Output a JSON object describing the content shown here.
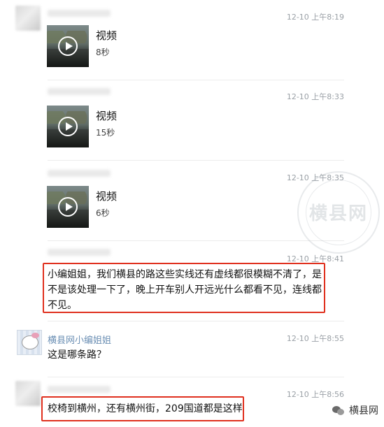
{
  "messages": [
    {
      "time": "12-10 上午8:19",
      "video_title": "视频",
      "video_duration": "8秒"
    },
    {
      "time": "12-10 上午8:33",
      "video_title": "视频",
      "video_duration": "15秒"
    },
    {
      "time": "12-10 上午8:35",
      "video_title": "视频",
      "video_duration": "6秒"
    },
    {
      "time": "12-10 上午8:41",
      "lines": [
        "小编姐姐，我们横县的路这些实线还有虚线都很模糊不清了，是",
        "不是该处理一下了，晚上开车别人开远光什么都看不见，连线都",
        "不见。"
      ]
    },
    {
      "time": "12-10 上午8:55",
      "name": "横县网小编姐姐",
      "text": "这是哪条路？"
    },
    {
      "time": "12-10 上午8:56",
      "text": "校椅到横州，还有横州街，209国道都是这样"
    }
  ],
  "watermark": "横县网",
  "brand": "横县网"
}
